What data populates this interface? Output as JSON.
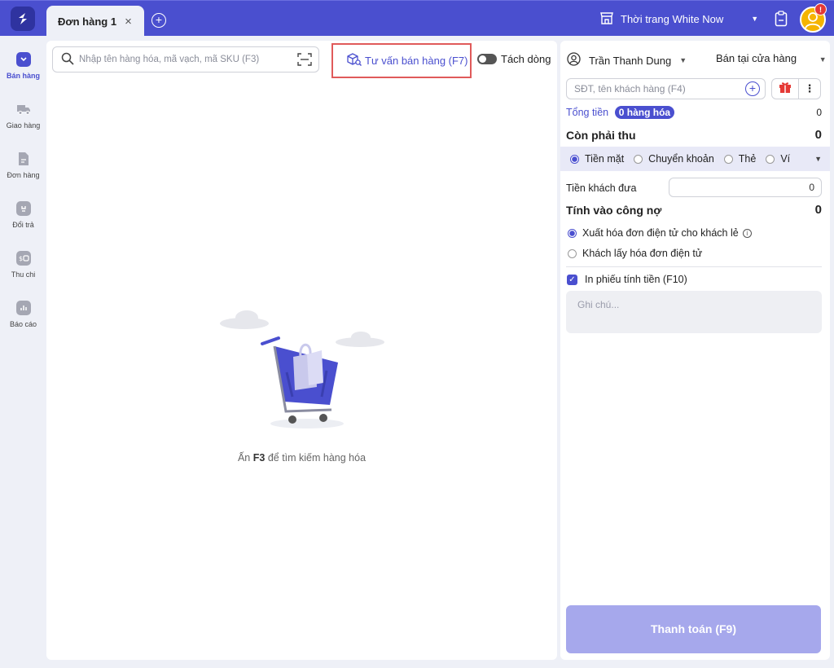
{
  "tabs": [
    {
      "label": "Đơn hàng",
      "number": "1",
      "close": "×"
    }
  ],
  "add_tab": "+",
  "store": {
    "name": "Thời trang White Now"
  },
  "notification_count": "!",
  "sidebar": {
    "items": [
      {
        "label": "Bán hàng",
        "icon": "cart-icon",
        "active": true
      },
      {
        "label": "Giao hàng",
        "icon": "truck-icon"
      },
      {
        "label": "Đơn hàng",
        "icon": "document-icon"
      },
      {
        "label": "Đổi trả",
        "icon": "return-box-icon"
      },
      {
        "label": "Thu chi",
        "icon": "cash-icon"
      },
      {
        "label": "Báo cáo",
        "icon": "report-chart-icon"
      }
    ]
  },
  "main": {
    "search_placeholder": "Nhập tên hàng hóa, mã vạch, mã SKU (F3)",
    "advise_label": "Tư vấn bán hàng (F7)",
    "split_label": "Tách dòng",
    "empty_prefix": "Ấn",
    "empty_key": "F3",
    "empty_suffix": "để tìm kiếm hàng hóa"
  },
  "right": {
    "staff_name": "Trần Thanh Dung",
    "channel": "Bán tại cửa hàng",
    "customer_placeholder": "SĐT, tên khách hàng (F4)",
    "more": "⋮",
    "total_label": "Tổng tiền",
    "items_badge": "0 hàng hóa",
    "total_value": "0",
    "remaining_label": "Còn phải thu",
    "remaining_value": "0",
    "payment_methods": [
      "Tiền mặt",
      "Chuyển khoản",
      "Thẻ",
      "Ví"
    ],
    "given_label": "Tiền khách đưa",
    "given_value": "0",
    "debt_label": "Tính vào công nợ",
    "debt_value": "0",
    "invoice_opt1": "Xuất hóa đơn điện tử cho khách lẻ",
    "invoice_opt2": "Khách lấy hóa đơn điện tử",
    "print_label": "In phiếu tính tiền (F10)",
    "note_placeholder": "Ghi chú...",
    "pay_button": "Thanh toán (F9)"
  },
  "colors": {
    "primary": "#4a4fcf",
    "highlight_box": "#e05a5a",
    "pay_button": "#a6a8ec"
  }
}
